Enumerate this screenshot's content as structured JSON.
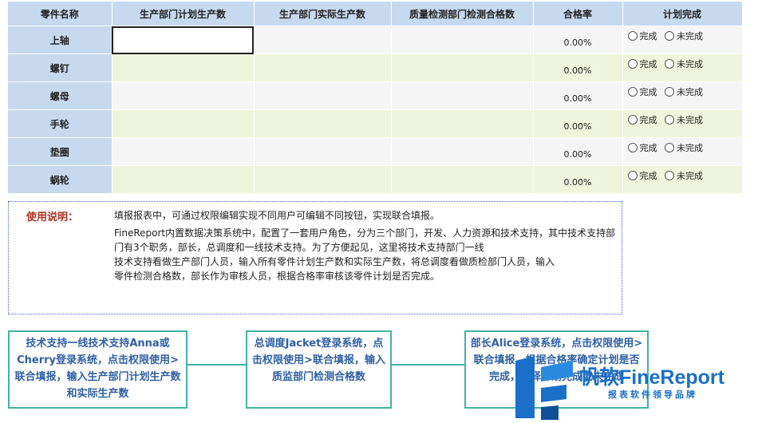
{
  "table": {
    "headers": [
      "零件名称",
      "生产部门计划生产数",
      "生产部门实际生产数",
      "质量检测部门检测合格数",
      "合格率",
      "计划完成"
    ],
    "rows": [
      {
        "name": "上轴",
        "rate": "0.00%"
      },
      {
        "name": "螺钉",
        "rate": "0.00%"
      },
      {
        "name": "螺母",
        "rate": "0.00%"
      },
      {
        "name": "手轮",
        "rate": "0.00%"
      },
      {
        "name": "垫圈",
        "rate": "0.00%"
      },
      {
        "name": "蜗轮",
        "rate": "0.00%"
      }
    ],
    "option_done": "完成",
    "option_undone": "未完成"
  },
  "note": {
    "title": "使用说明：",
    "lines": [
      "填报报表中，可通过权限编辑实现不同用户可编辑不同按钮，实现联合填报。",
      "FineReport内置数据决策系统中，配置了一套用户角色，分为三个部门，开发、人力资源和技术支持，其中技术支持部门有3个职务，部长，总调度和一线技术支持。为了方便起见，这里将技术支持部门一线",
      "技术支持看做生产部门人员，输入所有零件计划生产数和实际生产数，将总调度看做质检部门人员，输入",
      "零件检测合格数，部长作为审核人员，根据合格率审核该零件计划是否完成。"
    ]
  },
  "flow": [
    "技术支持一线技术支持Anna或Cherry登录系统，点击权限使用>联合填报，输入生产部门计划生产数和实际生产数",
    "总调度Jacket登录系统，点击权限使用>联合填报，输入质监部门检测合格数",
    "部长Alice登录系统，点击权限使用>联合填报，根据合格率确定计划是否完成，选择计划完成或未完成"
  ],
  "logo": {
    "cn": "帆软",
    "en": "FineReport",
    "tagline": "报表软件领导品牌"
  },
  "colors": {
    "header_bg": "#c7d9ef",
    "row_alt_green": "#eef5dc",
    "row_alt_gray": "#f5f5f5",
    "flow_border": "#3fb3a8",
    "flow_text": "#2d5fa6",
    "note_title": "#b03020",
    "brand_blue": "#1a6fc9"
  }
}
